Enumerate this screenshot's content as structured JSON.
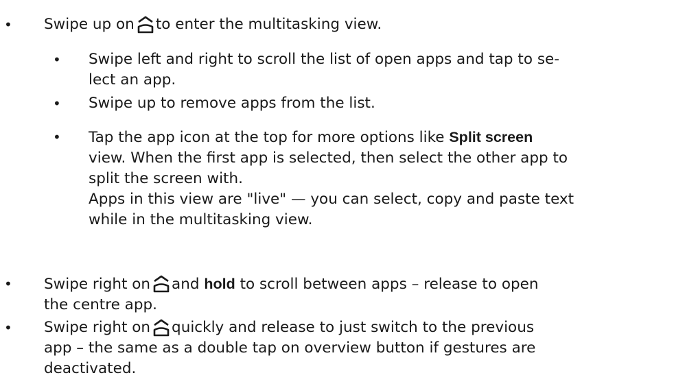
{
  "bullet_char": "•",
  "items": [
    {
      "pre": "Swipe up on",
      "post": "to enter the multitasking view."
    },
    {
      "line1": "Swipe left and right to scroll the list of open apps and tap to se-",
      "line2": "lect an app."
    },
    {
      "text": "Swipe up to remove apps from the list."
    },
    {
      "pre": "Tap the app icon at the top for more options like",
      "bold": "Split screen",
      "line2": "view. When the first app is selected, then select the other app to",
      "line3": "split the screen with.",
      "line4": "Apps in this view are \"live\" — you can select, copy and paste text",
      "line5": "while in the multitasking view."
    },
    {
      "pre": "Swipe right on",
      "mid": "and",
      "bold": "hold",
      "post": "to scroll between apps – release to open",
      "line2": "the centre app."
    },
    {
      "pre": "Swipe right on",
      "post": "quickly and release to just switch to the previous",
      "line2": "app – the same as a double tap on overview button if gestures are",
      "line3": "deactivated."
    }
  ],
  "icon": "home-gesture-icon"
}
